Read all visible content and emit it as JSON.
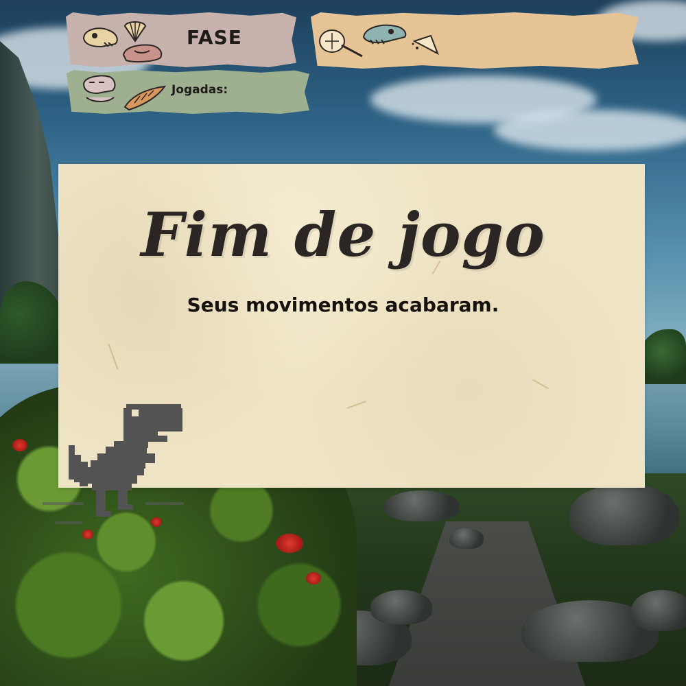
{
  "hud": {
    "fase": {
      "label": "FASE",
      "value": ""
    },
    "jogadas": {
      "label": "Jogadas:",
      "value": ""
    },
    "fossil_icons": [
      "skull-fossil-icon",
      "shell-fossil-icon",
      "trilobite-fossil-icon",
      "bone-fossil-icon",
      "dino-skull-fossil-icon",
      "tooth-fossil-icon"
    ]
  },
  "game_over": {
    "title": "Fim de jogo",
    "subtitle": "Seus movimentos acabaram."
  },
  "character": {
    "icon": "pixel-trex-icon",
    "color": "#535353"
  },
  "colors": {
    "tape_fase": "#c7b2ad",
    "tape_right": "#e7c496",
    "tape_jogadas": "#9eb08f",
    "panel": "#eee3c4",
    "text_dark": "#2b2624"
  }
}
